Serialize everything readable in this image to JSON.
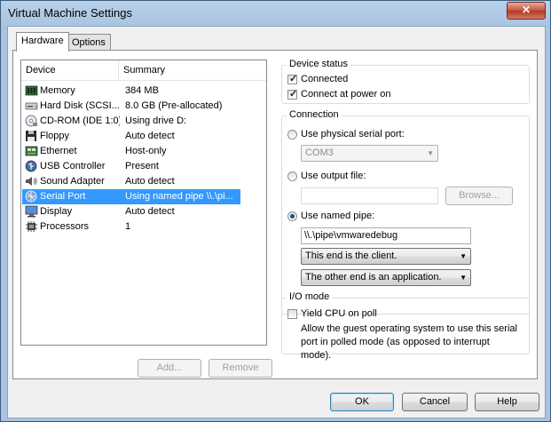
{
  "window": {
    "title": "Virtual Machine Settings",
    "close_glyph": "✕"
  },
  "tabs": [
    {
      "label": "Hardware",
      "active": true
    },
    {
      "label": "Options",
      "active": false
    }
  ],
  "device_list": {
    "columns": [
      "Device",
      "Summary"
    ],
    "rows": [
      {
        "device": "Memory",
        "summary": "384 MB",
        "icon": "memory-icon"
      },
      {
        "device": "Hard Disk (SCSI...",
        "summary": "8.0 GB (Pre-allocated)",
        "icon": "hard-disk-icon"
      },
      {
        "device": "CD-ROM (IDE 1:0)",
        "summary": "Using drive D:",
        "icon": "cdrom-icon"
      },
      {
        "device": "Floppy",
        "summary": "Auto detect",
        "icon": "floppy-icon"
      },
      {
        "device": "Ethernet",
        "summary": "Host-only",
        "icon": "ethernet-icon"
      },
      {
        "device": "USB Controller",
        "summary": "Present",
        "icon": "usb-icon"
      },
      {
        "device": "Sound Adapter",
        "summary": "Auto detect",
        "icon": "speaker-icon"
      },
      {
        "device": "Serial Port",
        "summary": "Using named pipe \\\\.\\pi...",
        "icon": "serial-port-icon",
        "selected": true
      },
      {
        "device": "Display",
        "summary": "Auto detect",
        "icon": "display-icon"
      },
      {
        "device": "Processors",
        "summary": "1",
        "icon": "processor-icon"
      }
    ]
  },
  "list_buttons": {
    "add": "Add...",
    "remove": "Remove"
  },
  "device_status": {
    "label": "Device status",
    "connected": {
      "label": "Connected",
      "checked": true
    },
    "connect_at_power_on": {
      "label": "Connect at power on",
      "checked": true
    }
  },
  "connection": {
    "label": "Connection",
    "physical": {
      "label": "Use physical serial port:",
      "value": "COM3"
    },
    "output_file": {
      "label": "Use output file:",
      "value": "",
      "browse": "Browse..."
    },
    "named_pipe": {
      "label": "Use named pipe:",
      "value": "\\\\.\\pipe\\vmwaredebug",
      "end_option": "This end is the client.",
      "other_end_option": "The other end is an application."
    }
  },
  "io_mode": {
    "label": "I/O mode",
    "yield": {
      "label": "Yield CPU on poll",
      "checked": false
    },
    "description": "Allow the guest operating system to use this serial port in polled mode (as opposed to interrupt mode)."
  },
  "footer": {
    "ok": "OK",
    "cancel": "Cancel",
    "help": "Help"
  },
  "glyphs": {
    "check": "✓",
    "dropdown": "▼"
  }
}
